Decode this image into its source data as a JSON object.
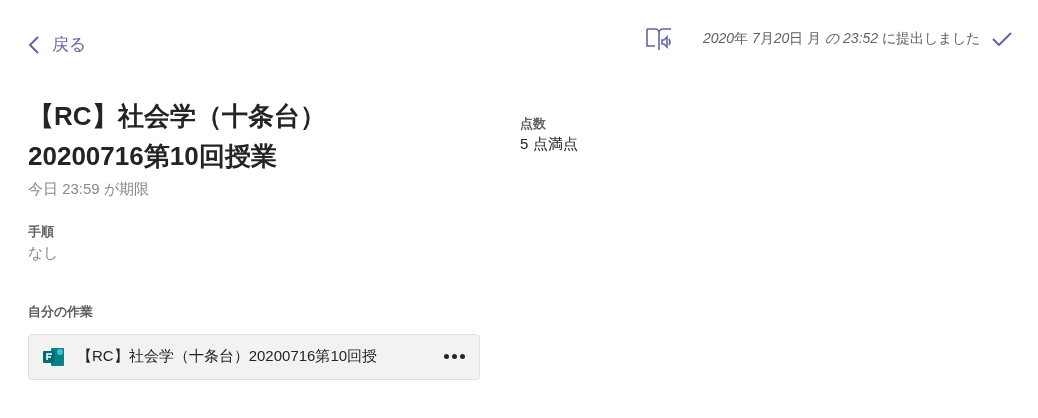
{
  "header": {
    "back_label": "戻る",
    "submitted": [
      {
        "text": "2020",
        "italic": true
      },
      {
        "text": "年 ",
        "italic": false
      },
      {
        "text": "7",
        "italic": true
      },
      {
        "text": "月",
        "italic": false
      },
      {
        "text": "20",
        "italic": true
      },
      {
        "text": "日 月 ",
        "italic": false
      },
      {
        "text": "の 23:52",
        "italic": true
      },
      {
        "text": " に提出しました",
        "italic": false
      }
    ]
  },
  "assignment": {
    "title_lines": [
      "【RC】社会学（十条台）",
      "20200716第10回授業"
    ],
    "due": "今日 23:59 が期限",
    "instructions_label": "手順",
    "instructions": "なし",
    "points_label": "点数",
    "points": "5 点満点"
  },
  "my_work": {
    "label": "自分の作業",
    "files": [
      {
        "name": "【RC】社会学（十条台）20200716第10回授"
      }
    ]
  }
}
